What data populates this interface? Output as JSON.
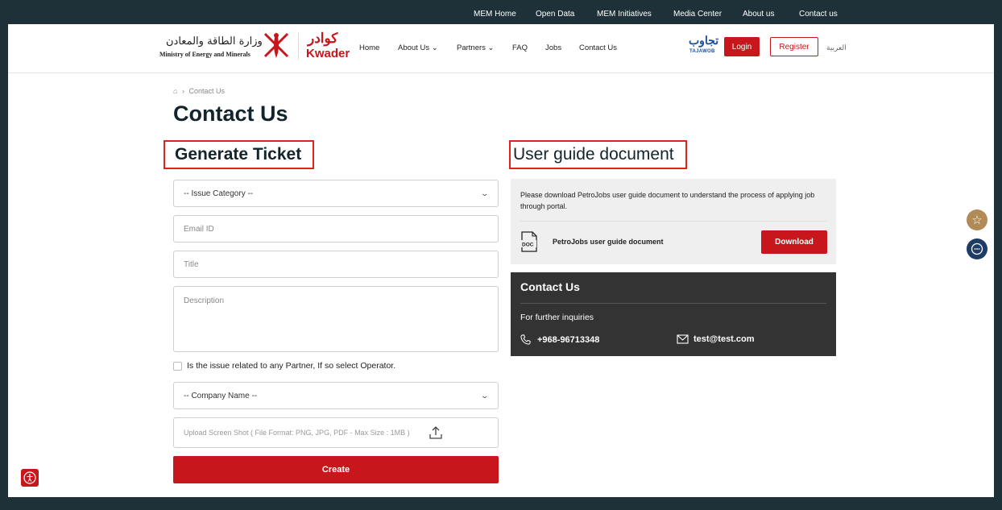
{
  "topbar": {
    "links": [
      "MEM Home",
      "Open Data",
      "MEM Initiatives",
      "Media Center",
      "About us",
      "Contact us"
    ]
  },
  "header": {
    "ministry_ar": "وزارة الطاقة والمعادن",
    "ministry_en": "Ministry of Energy and Minerals",
    "kwader_ar": "كوادر",
    "kwader_en": "Kwader",
    "nav": [
      "Home",
      "About Us ⌄",
      "Partners ⌄",
      "FAQ",
      "Jobs",
      "Contact Us"
    ],
    "tajawob_ar": "تجاوب",
    "tajawob_en": "TAJAWOB",
    "login_label": "Login",
    "register_label": "Register",
    "language_label": "العربية"
  },
  "breadcrumb": {
    "home_icon": "home-icon",
    "separator": "›",
    "current": "Contact Us"
  },
  "page_title": "Contact Us",
  "ticket": {
    "title": "Generate Ticket",
    "issue_category": "-- Issue Category --",
    "email_placeholder": "Email ID",
    "title_placeholder": "Title",
    "description_placeholder": "Description",
    "partner_checkbox_label": "Is the issue related to any Partner, If so select Operator.",
    "company_name": "-- Company Name --",
    "upload_placeholder": "Upload Screen Shot ( File Format: PNG, JPG, PDF - Max Size : 1MB )",
    "create_label": "Create"
  },
  "user_guide": {
    "title": "User guide document",
    "description": "Please download PetroJobs user guide document to understand the process of applying job through portal.",
    "doc_label": "PetroJobs user guide document",
    "doc_icon_text": "DOC",
    "download_label": "Download"
  },
  "contact": {
    "title": "Contact Us",
    "subtitle": "For further inquiries",
    "phone": "+968-96713348",
    "email": "test@test.com"
  },
  "colors": {
    "brand_red": "#c8161d",
    "topbar": "#1f3138",
    "contact_bg": "#333333",
    "highlight_border": "#e0231f"
  }
}
